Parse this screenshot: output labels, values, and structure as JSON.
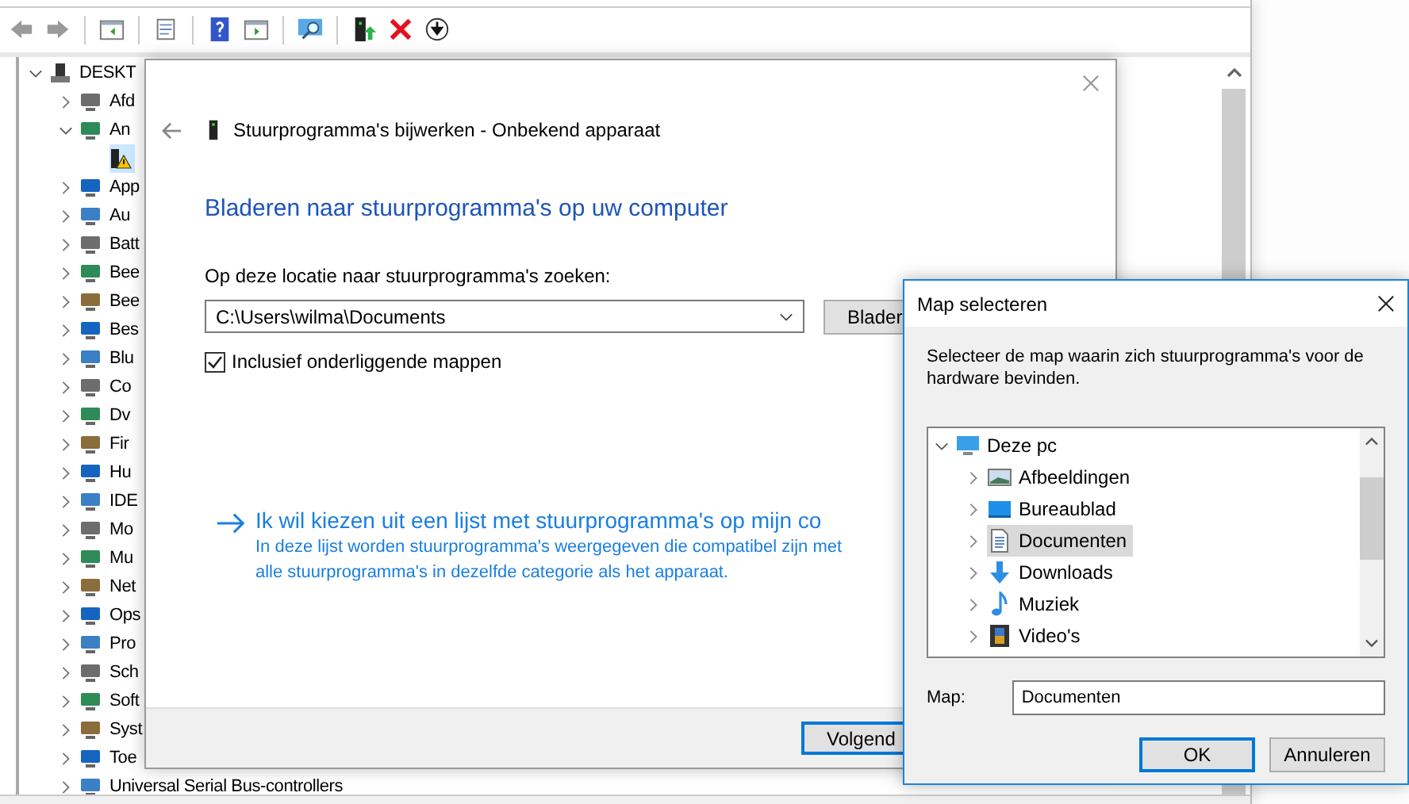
{
  "device_manager": {
    "tree": {
      "label": "DESKT",
      "expanded": true,
      "selected": false,
      "children": [
        {
          "label": "Afd",
          "expanded": false,
          "selected": false
        },
        {
          "label": "An",
          "expanded": true,
          "selected": false,
          "children": [
            {
              "selected": true,
              "warning": true
            }
          ]
        },
        {
          "label": "App",
          "expanded": false,
          "selected": false
        },
        {
          "label": "Au",
          "expanded": false,
          "selected": false
        },
        {
          "label": "Batt",
          "expanded": false,
          "selected": false
        },
        {
          "label": "Bee",
          "expanded": false,
          "selected": false
        },
        {
          "label": "Bee",
          "expanded": false,
          "selected": false
        },
        {
          "label": "Bes",
          "expanded": false,
          "selected": false
        },
        {
          "label": "Blu",
          "expanded": false,
          "selected": false
        },
        {
          "label": "Co",
          "expanded": false,
          "selected": false
        },
        {
          "label": "Dv",
          "expanded": false,
          "selected": false
        },
        {
          "label": "Fir",
          "expanded": false,
          "selected": false
        },
        {
          "label": "Hu",
          "expanded": false,
          "selected": false
        },
        {
          "label": "IDE",
          "expanded": false,
          "selected": false
        },
        {
          "label": "Mo",
          "expanded": false,
          "selected": false
        },
        {
          "label": "Mu",
          "expanded": false,
          "selected": false
        },
        {
          "label": "Net",
          "expanded": false,
          "selected": false
        },
        {
          "label": "Ops",
          "expanded": false,
          "selected": false
        },
        {
          "label": "Pro",
          "expanded": false,
          "selected": false
        },
        {
          "label": "Sch",
          "expanded": false,
          "selected": false
        },
        {
          "label": "Soft",
          "expanded": false,
          "selected": false
        },
        {
          "label": "Syst",
          "expanded": false,
          "selected": false
        },
        {
          "label": "Toe",
          "expanded": false,
          "selected": false
        },
        {
          "label": "Universal Serial Bus-controllers",
          "expanded": false,
          "selected": false
        }
      ]
    }
  },
  "update_wizard": {
    "title": "Stuurprogramma's bijwerken - Onbekend apparaat",
    "heading": "Bladeren naar stuurprogramma's op uw computer",
    "location_label": "Op deze locatie naar stuurprogramma's zoeken:",
    "location_value": "C:\\Users\\wilma\\Documents",
    "browse_button": "Blader",
    "include_subfolders": {
      "label": "Inclusief onderliggende mappen",
      "checked": true
    },
    "pick_link": {
      "title": "Ik wil kiezen uit een lijst met stuurprogramma's op mijn co",
      "description_lines": [
        "In deze lijst worden stuurprogramma's weergegeven die compatibel zijn met",
        "alle stuurprogramma's in dezelfde categorie als het apparaat."
      ]
    },
    "next_button": "Volgend"
  },
  "folder_dialog": {
    "title": "Map selecteren",
    "instruction": "Selecteer de map waarin zich stuurprogramma's voor de hardware bevinden.",
    "tree": {
      "label": "Deze pc",
      "expanded": true,
      "selected": false,
      "children": [
        {
          "label": "Afbeeldingen",
          "expanded": false,
          "selected": false
        },
        {
          "label": "Bureaublad",
          "expanded": false,
          "selected": false
        },
        {
          "label": "Documenten",
          "expanded": false,
          "selected": true
        },
        {
          "label": "Downloads",
          "expanded": false,
          "selected": false
        },
        {
          "label": "Muziek",
          "expanded": false,
          "selected": false
        },
        {
          "label": "Video's",
          "expanded": false,
          "selected": false
        }
      ]
    },
    "map_label": "Map:",
    "map_value": "Documenten",
    "buttons": [
      {
        "label": "OK",
        "default": true
      },
      {
        "label": "Annuleren",
        "default": false
      }
    ]
  }
}
